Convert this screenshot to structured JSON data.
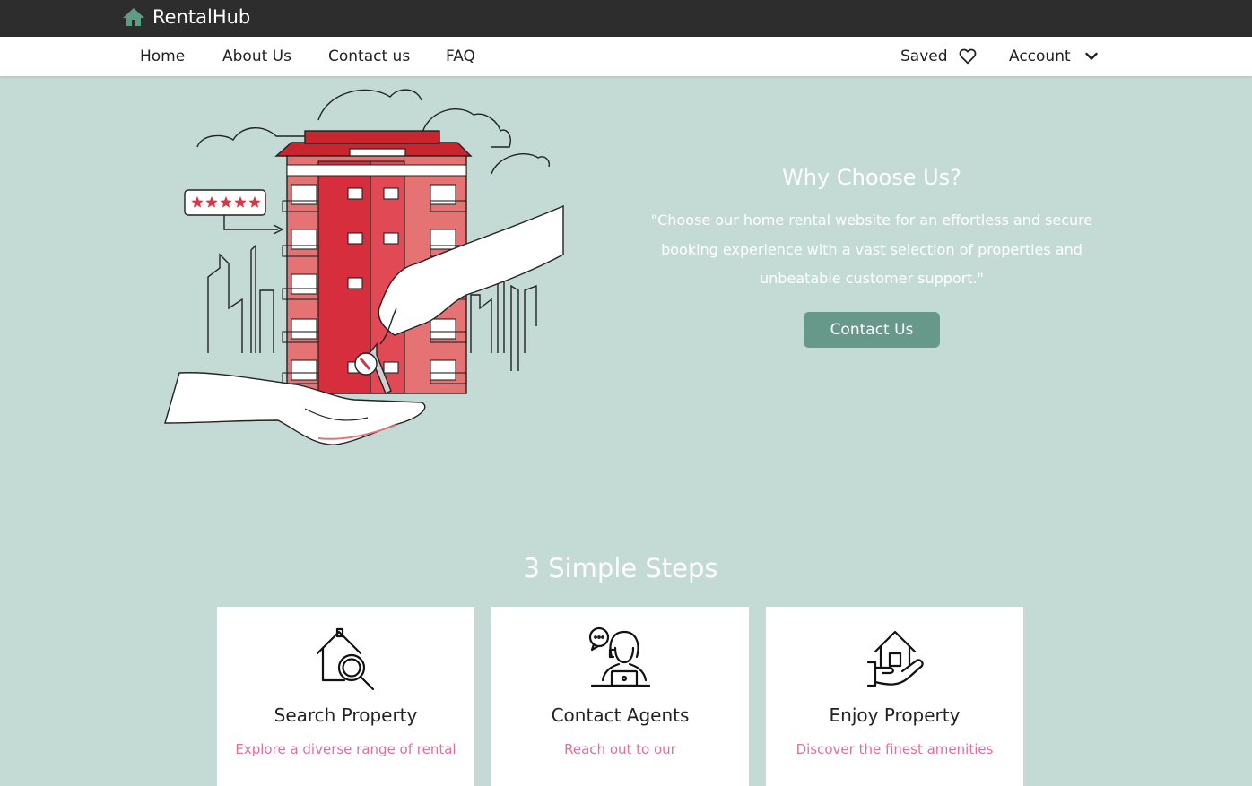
{
  "brand": {
    "name": "RentalHub",
    "icon": "home-icon",
    "icon_color": "#5f9c85"
  },
  "nav": {
    "items": [
      "Home",
      "About Us",
      "Contact us",
      "FAQ"
    ],
    "saved_label": "Saved",
    "account_label": "Account"
  },
  "illustration": {
    "rating_stars": 5,
    "star_color": "#d13a47"
  },
  "why": {
    "heading": "Why Choose Us?",
    "text": "\"Choose our home rental website for an effortless and secure booking experience with a vast selection of properties and unbeatable customer support.\"",
    "button_label": "Contact Us"
  },
  "steps": {
    "title": "3 Simple Steps",
    "cards": [
      {
        "title": "Search Property",
        "text": "Explore a diverse range of rental",
        "icon": "house-search-icon"
      },
      {
        "title": "Contact Agents",
        "text": "Reach out to our",
        "icon": "agent-icon"
      },
      {
        "title": "Enjoy Property",
        "text": "Discover the finest amenities",
        "icon": "house-in-hand-icon"
      }
    ]
  },
  "colors": {
    "topbar": "#2d2d2d",
    "background": "#c4dbd5",
    "button": "#66998a",
    "accent_text": "#e0709a"
  }
}
